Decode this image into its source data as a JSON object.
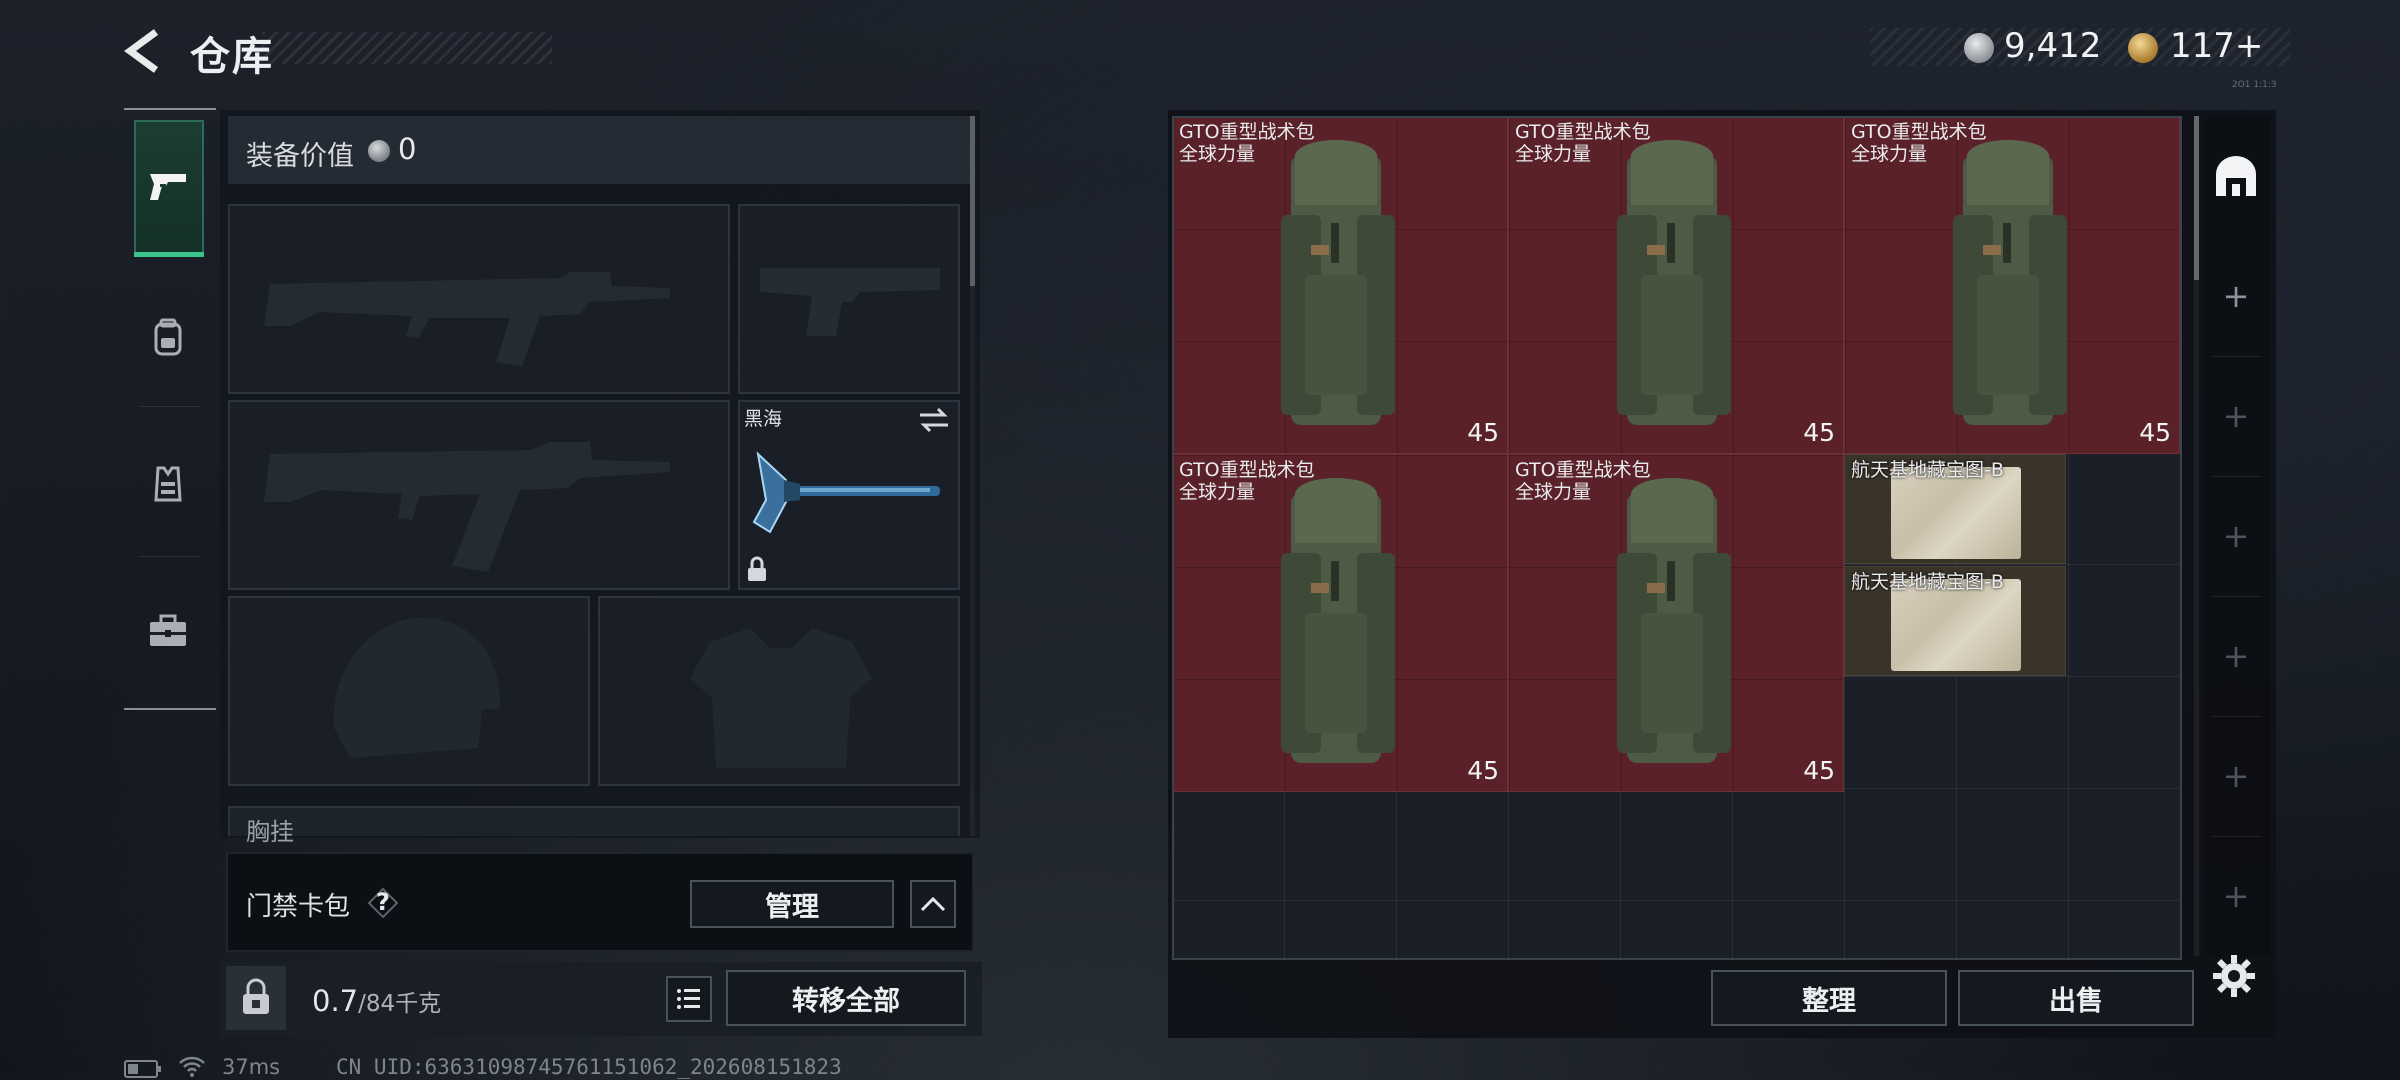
{
  "header": {
    "title": "仓库",
    "currency_silver": "9,412",
    "currency_gold": "117",
    "gold_suffix": "+",
    "build_tag": "2O1 1:1:3"
  },
  "nav": {
    "items": [
      {
        "name": "weapons",
        "icon": "pistol-icon",
        "active": true
      },
      {
        "name": "backpack",
        "icon": "backpack-icon",
        "active": false
      },
      {
        "name": "vest",
        "icon": "vest-icon",
        "active": false
      },
      {
        "name": "supplies",
        "icon": "toolbox-icon",
        "active": false
      }
    ]
  },
  "equipment": {
    "value_label": "装备价值",
    "value": "0",
    "melee_name": "黑海",
    "chest_label": "胸挂",
    "chest_icon": "help-icon"
  },
  "keycard": {
    "label": "门禁卡包",
    "help": "?",
    "manage_label": "管理"
  },
  "weight": {
    "current": "0.7",
    "max": "/84千克",
    "transfer_all_label": "转移全部"
  },
  "stash": {
    "items": [
      {
        "name": "GTO重型战术包",
        "sub": "全球力量",
        "capacity": "45"
      },
      {
        "name": "GTO重型战术包",
        "sub": "全球力量",
        "capacity": "45"
      },
      {
        "name": "GTO重型战术包",
        "sub": "全球力量",
        "capacity": "45"
      },
      {
        "name": "GTO重型战术包",
        "sub": "全球力量",
        "capacity": "45"
      },
      {
        "name": "GTO重型战术包",
        "sub": "全球力量",
        "capacity": "45"
      },
      {
        "name": "航天基地藏宝图-B"
      },
      {
        "name": "航天基地藏宝图-B"
      }
    ],
    "sort_label": "整理",
    "sell_label": "出售",
    "rail_plus": "+"
  },
  "status": {
    "ping": "37ms",
    "uid": "CN UID:6363109874576115106​2_202608151823"
  },
  "colors": {
    "accent_green": "#39c48a",
    "item_red": "#5a2228",
    "panel_dark": "#1b2028"
  }
}
